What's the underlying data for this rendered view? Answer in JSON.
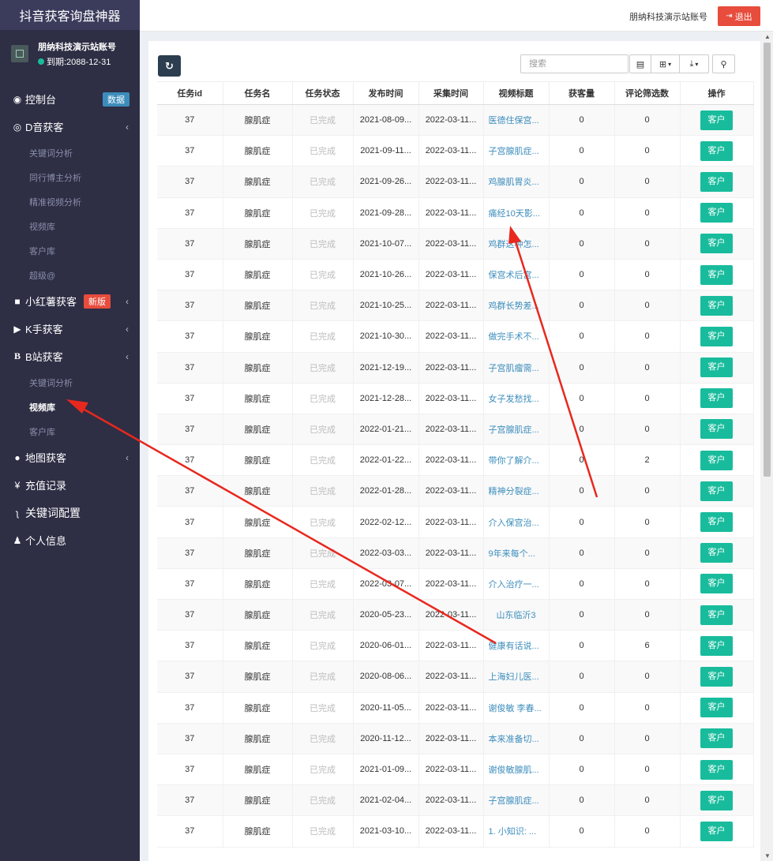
{
  "app": {
    "title": "抖音获客询盘神器"
  },
  "user": {
    "name": "朋纳科技演示站账号",
    "expire": "到期:2088-12-31"
  },
  "menu": {
    "dashboard": {
      "label": "控制台",
      "badge": "数据"
    },
    "douyin": {
      "label": "D音获客"
    },
    "douyin_sub": [
      "关键词分析",
      "同行博主分析",
      "精准视频分析",
      "视频库",
      "客户库",
      "超级@"
    ],
    "xhs": {
      "label": "小红薯获客",
      "badge": "新版"
    },
    "kuaishou": {
      "label": "K手获客"
    },
    "bili": {
      "label": "B站获客"
    },
    "bili_sub": [
      "关键词分析",
      "视频库",
      "客户库"
    ],
    "map": {
      "label": "地图获客"
    },
    "recharge": {
      "label": "充值记录"
    },
    "keyword_cfg": {
      "label": "关键词配置"
    },
    "profile": {
      "label": "个人信息"
    }
  },
  "header": {
    "account": "朋纳科技演示站账号",
    "logout": "退出"
  },
  "toolbar": {
    "search_placeholder": "搜索"
  },
  "table": {
    "columns": [
      "任务id",
      "任务名",
      "任务状态",
      "发布时间",
      "采集时间",
      "视频标题",
      "获客量",
      "评论筛选数",
      "操作"
    ],
    "action_label": "客户",
    "rows": [
      [
        "37",
        "腺肌症",
        "已完成",
        "2021-08-09...",
        "2022-03-11...",
        "医德住保宫...",
        "0",
        "0"
      ],
      [
        "37",
        "腺肌症",
        "已完成",
        "2021-09-11...",
        "2022-03-11...",
        "子宫腺肌症...",
        "0",
        "0"
      ],
      [
        "37",
        "腺肌症",
        "已完成",
        "2021-09-26...",
        "2022-03-11...",
        "鸡腺肌胃炎...",
        "0",
        "0"
      ],
      [
        "37",
        "腺肌症",
        "已完成",
        "2021-09-28...",
        "2022-03-11...",
        "痛经10天影...",
        "0",
        "0"
      ],
      [
        "37",
        "腺肌症",
        "已完成",
        "2021-10-07...",
        "2022-03-11...",
        "鸡群这种怎...",
        "0",
        "0"
      ],
      [
        "37",
        "腺肌症",
        "已完成",
        "2021-10-26...",
        "2022-03-11...",
        "保宫术后宫...",
        "0",
        "0"
      ],
      [
        "37",
        "腺肌症",
        "已完成",
        "2021-10-25...",
        "2022-03-11...",
        "鸡群长势差...",
        "0",
        "0"
      ],
      [
        "37",
        "腺肌症",
        "已完成",
        "2021-10-30...",
        "2022-03-11...",
        "做完手术不...",
        "0",
        "0"
      ],
      [
        "37",
        "腺肌症",
        "已完成",
        "2021-12-19...",
        "2022-03-11...",
        "子宫肌瘤需...",
        "0",
        "0"
      ],
      [
        "37",
        "腺肌症",
        "已完成",
        "2021-12-28...",
        "2022-03-11...",
        "女子发愁找...",
        "0",
        "0"
      ],
      [
        "37",
        "腺肌症",
        "已完成",
        "2022-01-21...",
        "2022-03-11...",
        "子宫腺肌症...",
        "0",
        "0"
      ],
      [
        "37",
        "腺肌症",
        "已完成",
        "2022-01-22...",
        "2022-03-11...",
        "带你了解介...",
        "0",
        "2"
      ],
      [
        "37",
        "腺肌症",
        "已完成",
        "2022-01-28...",
        "2022-03-11...",
        "精神分裂症...",
        "0",
        "0"
      ],
      [
        "37",
        "腺肌症",
        "已完成",
        "2022-02-12...",
        "2022-03-11...",
        "介入保宫治...",
        "0",
        "0"
      ],
      [
        "37",
        "腺肌症",
        "已完成",
        "2022-03-03...",
        "2022-03-11...",
        "9年来每个...",
        "0",
        "0"
      ],
      [
        "37",
        "腺肌症",
        "已完成",
        "2022-03-07...",
        "2022-03-11...",
        "介入治疗一...",
        "0",
        "0"
      ],
      [
        "37",
        "腺肌症",
        "已完成",
        "2020-05-23...",
        "2022-03-11...",
        "山东临沂3",
        "0",
        "0"
      ],
      [
        "37",
        "腺肌症",
        "已完成",
        "2020-06-01...",
        "2022-03-11...",
        "健康有话说...",
        "0",
        "6"
      ],
      [
        "37",
        "腺肌症",
        "已完成",
        "2020-08-06...",
        "2022-03-11...",
        "上海妇儿医...",
        "0",
        "0"
      ],
      [
        "37",
        "腺肌症",
        "已完成",
        "2020-11-05...",
        "2022-03-11...",
        "谢俊敏 李春...",
        "0",
        "0"
      ],
      [
        "37",
        "腺肌症",
        "已完成",
        "2020-11-12...",
        "2022-03-11...",
        "本来准备切...",
        "0",
        "0"
      ],
      [
        "37",
        "腺肌症",
        "已完成",
        "2021-01-09...",
        "2022-03-11...",
        "谢俊敏腺肌...",
        "0",
        "0"
      ],
      [
        "37",
        "腺肌症",
        "已完成",
        "2021-02-04...",
        "2022-03-11...",
        "子宫腺肌症...",
        "0",
        "0"
      ],
      [
        "37",
        "腺肌症",
        "已完成",
        "2021-03-10...",
        "2022-03-11...",
        "1. 小知识: ...",
        "0",
        "0"
      ]
    ]
  },
  "colors": {
    "sidebar": "#2e2e45",
    "accent_green": "#18bc9c",
    "link_blue": "#3c8dbc",
    "logout_red": "#e74c3c",
    "annotation_red": "#e8281e"
  }
}
